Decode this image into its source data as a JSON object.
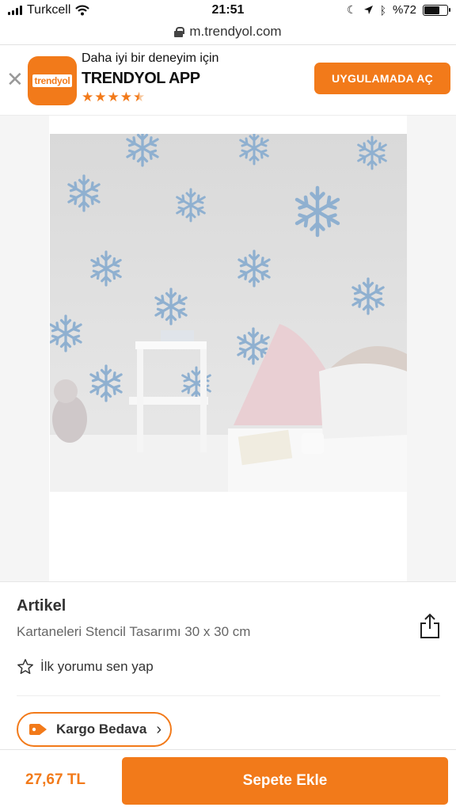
{
  "status_bar": {
    "carrier": "Turkcell",
    "time": "21:51",
    "battery_text": "%72",
    "battery_level": 0.72
  },
  "url_bar": {
    "url": "m.trendyol.com"
  },
  "app_banner": {
    "icon_text": "trendyol",
    "subtitle": "Daha iyi bir deneyim için",
    "title": "TRENDYOL APP",
    "rating": 4.5,
    "open_label": "UYGULAMADA AÇ"
  },
  "product": {
    "brand": "Artikel",
    "name": "Kartaneleri Stencil Tasarımı 30 x 30 cm",
    "review_prompt": "İlk yorumu sen yap",
    "shipping_badge": "Kargo Bedava"
  },
  "footer": {
    "price": "27,67 TL",
    "add_to_cart_label": "Sepete Ekle"
  },
  "colors": {
    "accent": "#f27a1a",
    "snowflake": "#8fb0d0"
  }
}
